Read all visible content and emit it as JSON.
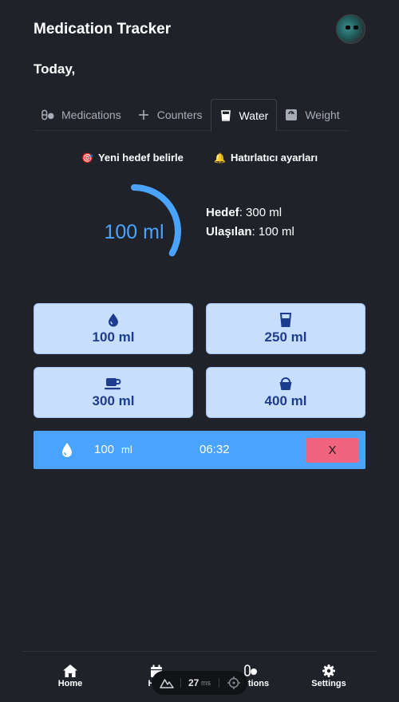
{
  "app": {
    "title": "Medication Tracker"
  },
  "greeting": "Today,",
  "tabs": [
    {
      "label": "Medications",
      "icon": "pills-icon",
      "active": false
    },
    {
      "label": "Counters",
      "icon": "plus-icon",
      "active": false
    },
    {
      "label": "Water",
      "icon": "glass-icon",
      "active": true
    },
    {
      "label": "Weight",
      "icon": "scale-icon",
      "active": false
    }
  ],
  "actions": {
    "set_goal": "Yeni hedef belirle",
    "set_goal_icon": "🎯",
    "reminders": "Hatırlatıcı ayarları",
    "reminders_icon": "🔔"
  },
  "progress": {
    "display": "100 ml",
    "current_ml": 100,
    "goal_ml": 300,
    "fraction": 0.333
  },
  "goal": {
    "goal_label": "Hedef",
    "goal_value": ": 300 ml",
    "achieved_label": "Ulaşılan",
    "achieved_value": ": 100 ml"
  },
  "quick_add": [
    {
      "label": "100 ml",
      "icon": "water-drop-icon"
    },
    {
      "label": "250 ml",
      "icon": "glass-icon"
    },
    {
      "label": "300 ml",
      "icon": "mug-icon"
    },
    {
      "label": "400 ml",
      "icon": "bucket-icon"
    }
  ],
  "log": {
    "amount": "100",
    "unit": "ml",
    "time": "06:32",
    "delete_label": "X",
    "icon": "water-drop-icon"
  },
  "nav": [
    {
      "label": "Home",
      "icon": "home-icon"
    },
    {
      "label": "Hi",
      "icon": "calendar-icon"
    },
    {
      "label": "tions",
      "icon": "pills-icon"
    },
    {
      "label": "Settings",
      "icon": "gear-icon"
    }
  ],
  "perf_badge": {
    "value": "27",
    "unit": "ms"
  },
  "colors": {
    "background": "#1f2329",
    "accent": "#4aa3ff",
    "button_bg": "#c7deff",
    "button_text": "#1d3c8f",
    "delete": "#f0647f"
  }
}
